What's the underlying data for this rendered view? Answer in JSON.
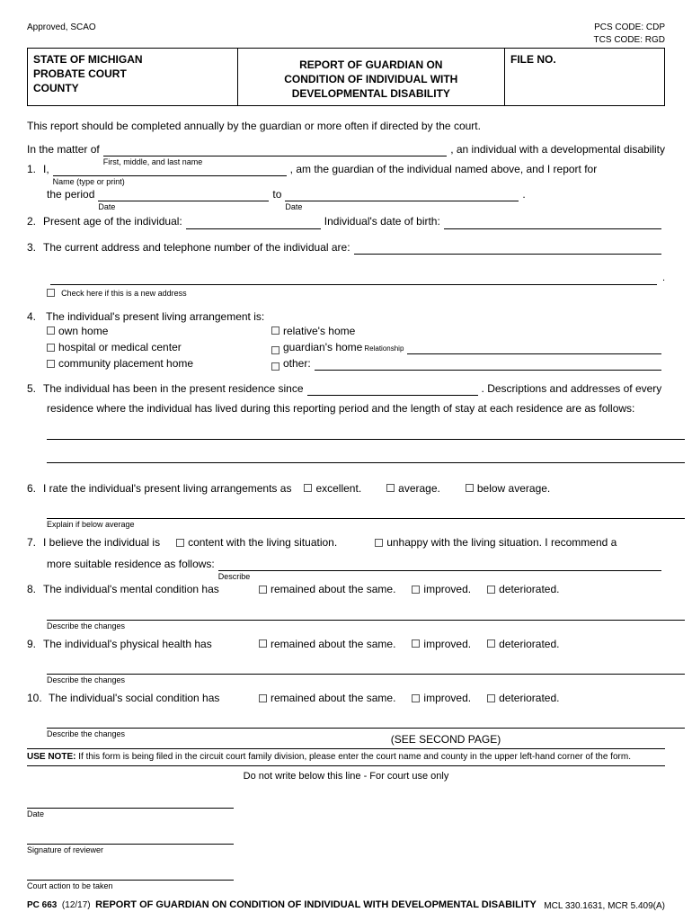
{
  "top": {
    "approved": "Approved, SCAO",
    "pcs": "PCS CODE: CDP",
    "tcs": "TCS CODE: RGD"
  },
  "header": {
    "leftLine1": "STATE OF MICHIGAN",
    "leftLine2": "PROBATE COURT",
    "leftLine3": "COUNTY",
    "title1": "REPORT OF GUARDIAN ON",
    "title2": "CONDITION OF INDIVIDUAL WITH",
    "title3": "DEVELOPMENTAL DISABILITY",
    "fileNo": "FILE NO."
  },
  "intro": "This report should be completed annually by the guardian or more often if directed by the court.",
  "matter": {
    "prefix": "In the matter of",
    "caption": "First, middle, and last name",
    "suffix": ", an individual with a developmental disability"
  },
  "q1": {
    "num": "1.",
    "iPrefix": "I,",
    "nameCaption": "Name (type or print)",
    "iSuffix": ", am the guardian of the individual named above, and I report for",
    "periodPrefix": "the period",
    "dateCaption": "Date",
    "to": "to",
    "periodSuffix": "."
  },
  "q2": {
    "num": "2.",
    "text1": "Present age of the individual:",
    "text2": "Individual's date of birth:"
  },
  "q3": {
    "num": "3.",
    "text": "The current address and telephone number of the individual are:",
    "chkLabel": "Check here if this is a new address"
  },
  "q4": {
    "num": "4.",
    "text": "The individual's present living arrangement is:",
    "opt1": "own home",
    "opt2": "relative's home",
    "opt3": "hospital or medical center",
    "opt4": "guardian's home",
    "opt4sup": "Relationship",
    "opt5": "community placement home",
    "opt6": "other:"
  },
  "q5": {
    "num": "5.",
    "text1": "The individual has been in the present residence since",
    "text2": ". Descriptions and addresses of every",
    "text3": "residence where the individual has lived during this reporting period and the length of stay at each residence are as follows:"
  },
  "q6": {
    "num": "6.",
    "text": "I rate the individual's present living arrangements as",
    "opt1": "excellent.",
    "opt2": "average.",
    "opt3": "below average.",
    "caption": "Explain if below average"
  },
  "q7": {
    "num": "7.",
    "text": "I believe the individual is",
    "opt1": "content with the living situation.",
    "opt2": "unhappy with the living situation. I recommend a",
    "text2": "more suitable residence as follows:",
    "caption": "Describe"
  },
  "q8": {
    "num": "8.",
    "text": "The individual's mental condition has",
    "opt1": "remained about the same.",
    "opt2": "improved.",
    "opt3": "deteriorated.",
    "caption": "Describe the changes"
  },
  "q9": {
    "num": "9.",
    "text": "The individual's physical health has",
    "opt1": "remained about the same.",
    "opt2": "improved.",
    "opt3": "deteriorated.",
    "caption": "Describe the changes"
  },
  "q10": {
    "num": "10.",
    "text": "The individual's social condition has",
    "opt1": "remained about the same.",
    "opt2": "improved.",
    "opt3": "deteriorated.",
    "caption": "Describe the changes"
  },
  "see": "(SEE SECOND PAGE)",
  "usenote": {
    "bold": "USE NOTE:",
    "text": "If this form is being filed in the circuit court family division, please enter the court name and county in the upper left-hand corner of the form."
  },
  "courtonly": "Do not write below this line - For court use only",
  "sig": {
    "date": "Date",
    "reviewer": "Signature of reviewer",
    "action": "Court action to be taken"
  },
  "footer": {
    "formNo": "PC  663",
    "rev": "(12/17)",
    "title": "REPORT OF GUARDIAN ON CONDITION OF INDIVIDUAL WITH DEVELOPMENTAL DISABILITY",
    "mcl": "MCL 330.1631, MCR 5.409(A)"
  }
}
